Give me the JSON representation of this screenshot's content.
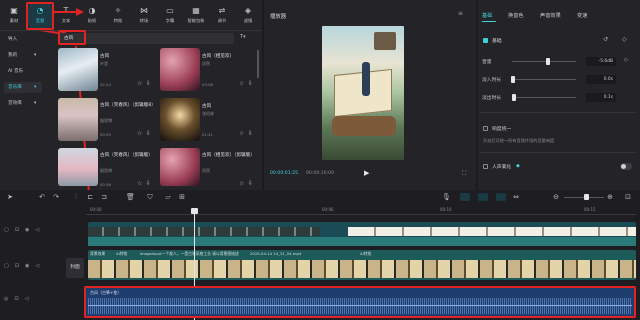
{
  "toolbar": {
    "items": [
      {
        "label": "素材",
        "icon": "media-icon"
      },
      {
        "label": "音频",
        "icon": "audio-icon"
      },
      {
        "label": "文本",
        "icon": "text-icon"
      },
      {
        "label": "贴纸",
        "icon": "sticker-icon"
      },
      {
        "label": "特效",
        "icon": "effects-icon"
      },
      {
        "label": "转场",
        "icon": "transition-icon"
      },
      {
        "label": "字幕",
        "icon": "subtitle-icon"
      },
      {
        "label": "智能包装",
        "icon": "smart-pack-icon"
      },
      {
        "label": "调节",
        "icon": "adjust-icon"
      },
      {
        "label": "滤镜",
        "icon": "filter-icon"
      }
    ],
    "active": "音频"
  },
  "audio_panel": {
    "categories": [
      {
        "label": "导入",
        "expandable": false
      },
      {
        "label": "我的",
        "expandable": true
      },
      {
        "label": "AI 音乐",
        "expandable": false
      },
      {
        "label": "音乐库",
        "expandable": true,
        "selected": true
      },
      {
        "label": "音效库",
        "expandable": true
      }
    ],
    "search_value": "古风",
    "filter_label": "T",
    "results": [
      {
        "title": "古风",
        "artist": "叶里",
        "duration": "02:24"
      },
      {
        "title": "古风（相见欢）",
        "artist": "初然",
        "duration": "03:08"
      },
      {
        "title": "古风（笑春风）（剪辑版8）",
        "artist": "殷思博",
        "duration": "00:55"
      },
      {
        "title": "古风",
        "artist": "张绍林",
        "duration": "01:41"
      },
      {
        "title": "古风（笑春风）（剪辑版）",
        "artist": "殷思博",
        "duration": "00:56"
      },
      {
        "title": "古风（相见欢）（剪辑版）",
        "artist": "初然",
        "duration": ""
      }
    ]
  },
  "player": {
    "title": "播放器",
    "time_current": "00:00:01:25",
    "time_total": "00:00:16:00"
  },
  "properties": {
    "tabs": [
      "基础",
      "换音色",
      "声音效果",
      "变速"
    ],
    "active_tab": "基础",
    "section_basic": "基础",
    "volume_label": "音量",
    "volume_value": "-5.6dB",
    "fade_in_label": "淡入时长",
    "fade_in_value": "0.0s",
    "fade_out_label": "淡出时长",
    "fade_out_value": "0.1s",
    "denoise_label": "响度统一",
    "denoise_desc": "开启后可统一所有音频片段的音量响度",
    "enhance_label": "人声美化"
  },
  "timeline": {
    "ruler_labels": [
      "00:00",
      "00:06",
      "00:10",
      "00:15"
    ],
    "cover_label": "封面",
    "text_track_caption": "AI特效...",
    "video_caption_1": "背景效果",
    "video_caption_2": "AI特效",
    "video_caption_3": "imageinput一个故人，一是古装风格工业 请以背景图描述",
    "video_caption_4": "2025-04-14 14_31_04.mp4",
    "video_caption_5": "AI特效",
    "audio_clip_label": "古风（古筝+笙）"
  },
  "colors": {
    "accent": "#3fd3d8",
    "annotation_red": "#e02424",
    "audio_clip": "#1e3c6e",
    "video_track": "#1d6466"
  }
}
